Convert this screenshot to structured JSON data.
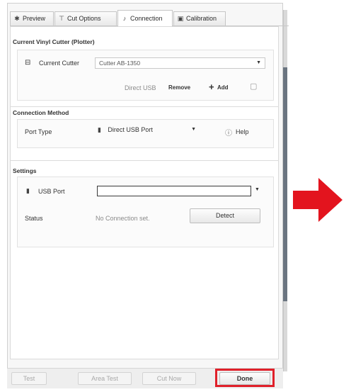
{
  "tabs": [
    {
      "label": "Preview",
      "icon": "star-icon"
    },
    {
      "label": "Cut Options",
      "icon": "cutter-icon"
    },
    {
      "label": "Connection",
      "icon": "connection-icon"
    },
    {
      "label": "Calibration",
      "icon": "calibration-icon"
    }
  ],
  "active_tab": "Connection",
  "current_cutter": {
    "section_title": "Current Vinyl Cutter (Plotter)",
    "label": "Current Cutter",
    "selected": "Cutter AB-1350",
    "connection_info": "Direct USB",
    "remove_label": "Remove",
    "add_label": "Add"
  },
  "connection_method": {
    "section_title": "Connection Method",
    "port_type_label": "Port Type",
    "port_type_value": "Direct USB Port",
    "help_label": "Help"
  },
  "settings": {
    "section_title": "Settings",
    "usb_port_label": "USB Port",
    "usb_port_value": "",
    "status_label": "Status",
    "status_value": "No Connection set.",
    "detect_label": "Detect"
  },
  "footer": {
    "test_label": "Test",
    "area_test_label": "Area Test",
    "cut_now_label": "Cut Now",
    "done_label": "Done"
  },
  "colors": {
    "highlight": "#e0202a",
    "arrow": "#e3141e"
  }
}
